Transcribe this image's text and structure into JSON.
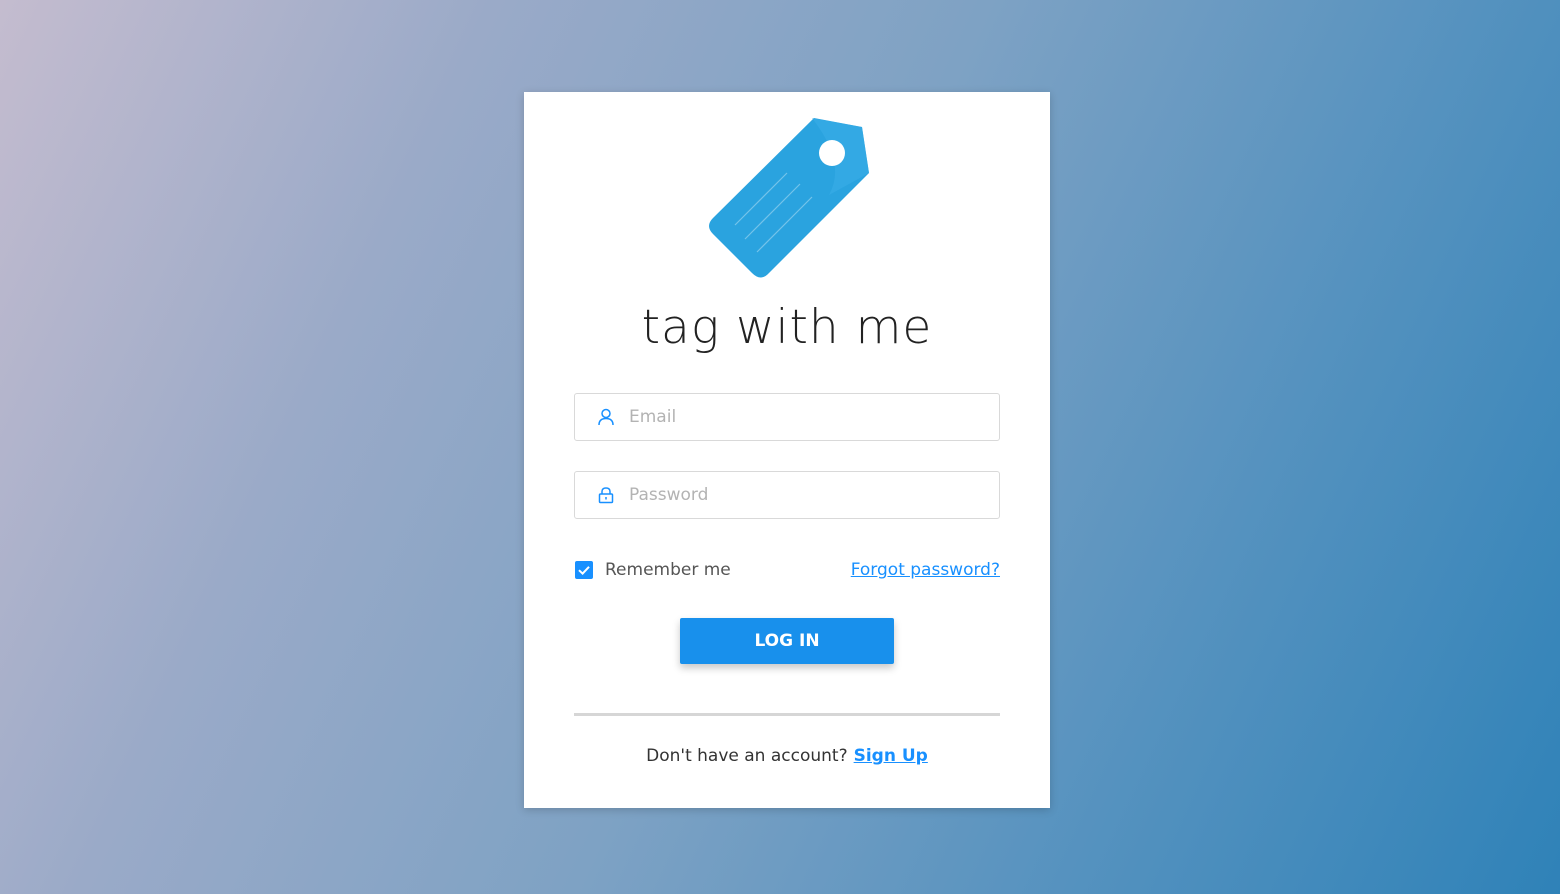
{
  "brand": {
    "name": "tag with me",
    "logo_icon": "price-tag-icon",
    "accent_color": "#1890ff"
  },
  "form": {
    "email": {
      "placeholder": "Email",
      "value": "",
      "icon": "user-icon"
    },
    "password": {
      "placeholder": "Password",
      "value": "",
      "icon": "lock-icon"
    },
    "remember": {
      "label": "Remember me",
      "checked": true
    },
    "forgot_label": "Forgot password?",
    "login_label": "LOG IN"
  },
  "footer": {
    "prompt": "Don't have an account?",
    "signup_label": "Sign Up"
  }
}
